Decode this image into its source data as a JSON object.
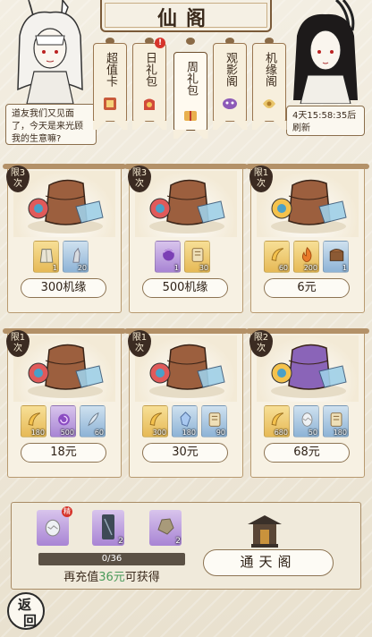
{
  "header": {
    "title": "仙阁"
  },
  "tabs": [
    {
      "label": "超值卡",
      "icon": "card-icon",
      "active": false
    },
    {
      "label": "日礼包",
      "icon": "gift-bag-icon",
      "active": false,
      "badge": "!"
    },
    {
      "label": "周礼包",
      "icon": "weekly-gift-icon",
      "active": true
    },
    {
      "label": "观影阁",
      "icon": "mask-icon",
      "active": false
    },
    {
      "label": "机缘阁",
      "icon": "scroll-icon",
      "active": false
    }
  ],
  "npc_left": {
    "speech": "道友我们又见面了，今天是来光顾我的生意嘛?"
  },
  "npc_right": {
    "speech": "4天15:58:35后刷新"
  },
  "cards": [
    {
      "limit": "限3次",
      "items": [
        {
          "icon": "robe-icon",
          "count": "1",
          "quality": "gold"
        },
        {
          "icon": "statue-icon",
          "count": "20",
          "quality": "blue"
        }
      ],
      "price": "300机缘"
    },
    {
      "limit": "限3次",
      "items": [
        {
          "icon": "purple-orb-icon",
          "count": "1",
          "quality": "purple"
        },
        {
          "icon": "scroll-icon",
          "count": "30",
          "quality": "gold"
        }
      ],
      "price": "500机缘"
    },
    {
      "limit": "限1次",
      "items": [
        {
          "icon": "horn-icon",
          "count": "60",
          "quality": "gold"
        },
        {
          "icon": "flame-icon",
          "count": "200",
          "quality": "gold"
        },
        {
          "icon": "chest-icon",
          "count": "1",
          "quality": "blue"
        }
      ],
      "price": "6元"
    },
    {
      "limit": "限1次",
      "items": [
        {
          "icon": "horn-icon",
          "count": "180",
          "quality": "gold"
        },
        {
          "icon": "spiral-icon",
          "count": "500",
          "quality": "purple"
        },
        {
          "icon": "feather-icon",
          "count": "60",
          "quality": "blue"
        }
      ],
      "price": "18元"
    },
    {
      "limit": "限1次",
      "items": [
        {
          "icon": "horn-icon",
          "count": "300",
          "quality": "gold"
        },
        {
          "icon": "crystal-icon",
          "count": "180",
          "quality": "blue"
        },
        {
          "icon": "scroll-icon",
          "count": "90",
          "quality": "blue"
        }
      ],
      "price": "30元"
    },
    {
      "limit": "限2次",
      "items": [
        {
          "icon": "horn-icon",
          "count": "680",
          "quality": "gold"
        },
        {
          "icon": "egg-icon",
          "count": "50",
          "quality": "blue"
        },
        {
          "icon": "scroll-icon",
          "count": "180",
          "quality": "blue"
        }
      ],
      "price": "68元"
    }
  ],
  "reward": {
    "items": [
      {
        "icon": "egg-icon",
        "count": "",
        "quality": "purple",
        "badge": "精"
      },
      {
        "icon": "tablet-icon",
        "count": "2",
        "quality": "purple"
      },
      {
        "icon": "ore-icon",
        "count": "2",
        "quality": "purple"
      }
    ],
    "progress_text": "0/36",
    "progress": 0,
    "recharge_prefix": "再充值",
    "recharge_amount": "36元",
    "recharge_suffix": "可获得",
    "button_label": "通天阁"
  },
  "back_label": "返回"
}
